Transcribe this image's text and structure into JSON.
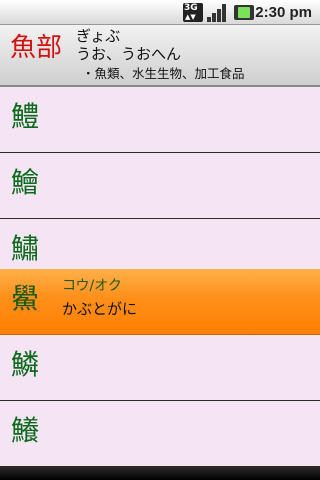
{
  "status_bar": {
    "network": "3G",
    "time": "2:30 pm",
    "icons": [
      "network-3g-icon",
      "signal-strength-icon",
      "battery-charging-icon"
    ]
  },
  "header": {
    "radical": "魚部",
    "reading_1": "ぎょぶ",
    "reading_2": "うお、うおへん",
    "categories": "・魚類、水生生物、加工食品"
  },
  "list": [
    {
      "kanji": "鱧",
      "reading": "",
      "meaning": ""
    },
    {
      "kanji": "鱠",
      "reading": "",
      "meaning": ""
    },
    {
      "kanji": "鱐",
      "reading": "",
      "meaning": ""
    },
    {
      "kanji": "鱟",
      "reading": "コウ/オク",
      "meaning": "かぶとがに"
    },
    {
      "kanji": "鱗",
      "reading": "",
      "meaning": ""
    },
    {
      "kanji": "鱶",
      "reading": "",
      "meaning": ""
    }
  ],
  "colors": {
    "radical": "#d41010",
    "kanji": "#0c6a1c",
    "list_background": "#f4e4f4",
    "selected": "#ff8f1a"
  }
}
